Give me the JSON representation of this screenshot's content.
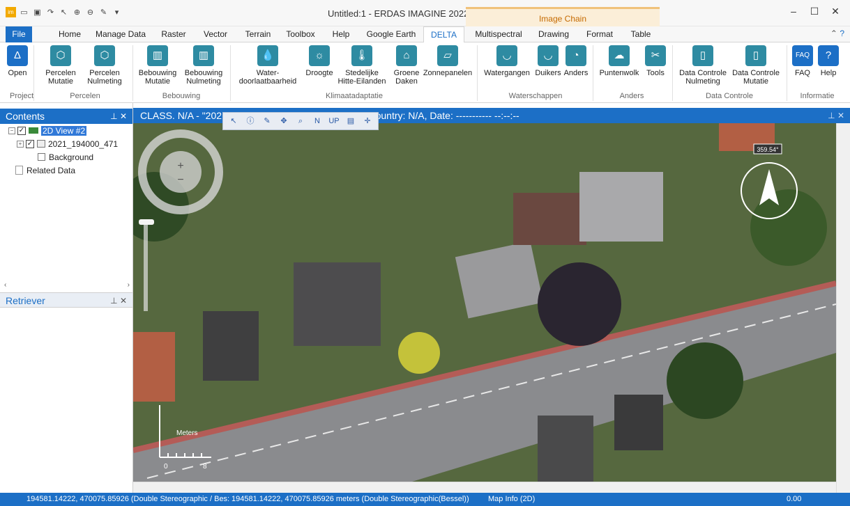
{
  "window": {
    "title": "Untitled:1 - ERDAS IMAGINE 2022",
    "context_group": "Image Chain"
  },
  "qat": {
    "icons": [
      "app-icon",
      "folder-icon",
      "save-icon",
      "redo-icon",
      "select-icon",
      "zoom-in-icon",
      "zoom-out-icon",
      "pen-icon",
      "customize-icon"
    ]
  },
  "tabs": [
    "File",
    "Home",
    "Manage Data",
    "Raster",
    "Vector",
    "Terrain",
    "Toolbox",
    "Help",
    "Google Earth",
    "DELTA",
    "Multispectral",
    "Drawing",
    "Format",
    "Table"
  ],
  "ribbon": {
    "buttons": [
      {
        "l1": "Open",
        "l2": ""
      },
      {
        "l1": "Percelen",
        "l2": "Mutatie"
      },
      {
        "l1": "Percelen",
        "l2": "Nulmeting"
      },
      {
        "l1": "Bebouwing",
        "l2": "Mutatie"
      },
      {
        "l1": "Bebouwing",
        "l2": "Nulmeting"
      },
      {
        "l1": "Water-",
        "l2": "doorlaatbaarheid"
      },
      {
        "l1": "Droogte",
        "l2": ""
      },
      {
        "l1": "Stedelijke",
        "l2": "Hitte-Eilanden"
      },
      {
        "l1": "Groene",
        "l2": "Daken"
      },
      {
        "l1": "Zonnepanelen",
        "l2": ""
      },
      {
        "l1": "Watergangen",
        "l2": ""
      },
      {
        "l1": "Duikers",
        "l2": ""
      },
      {
        "l1": "Anders",
        "l2": ""
      },
      {
        "l1": "Puntenwolk",
        "l2": ""
      },
      {
        "l1": "Tools",
        "l2": ""
      },
      {
        "l1": "Data Controle",
        "l2": "Nulmeting"
      },
      {
        "l1": "Data Controle",
        "l2": "Mutatie"
      },
      {
        "l1": "FAQ",
        "l2": ""
      },
      {
        "l1": "Help",
        "l2": ""
      }
    ],
    "groups": [
      "Project",
      "Percelen",
      "Bebouwing",
      "Klimaatadaptatie",
      "Waterschappen",
      "Anders",
      "Data Controle",
      "Informatie"
    ]
  },
  "contents": {
    "title": "Contents",
    "items": [
      "2D View #2",
      "2021_194000_471",
      "Background",
      "Related Data"
    ]
  },
  "retriever": {
    "title": "Retriever"
  },
  "view": {
    "header": "CLASS. N/A - \"2021_194000_471000_RGB_hrl.tif\" - Country: N/A, Date: ----------- --:--:--",
    "compass": "359.54°",
    "scale_label": "Meters",
    "scale_ticks": [
      "0",
      "8"
    ]
  },
  "status": {
    "left": "194581.14222, 470075.85926  (Double Stereographic / Bes:",
    "middle": "194581.14222, 470075.85926 meters (Double Stereographic(Bessel))",
    "info": "Map Info (2D)",
    "right": "0.00"
  }
}
